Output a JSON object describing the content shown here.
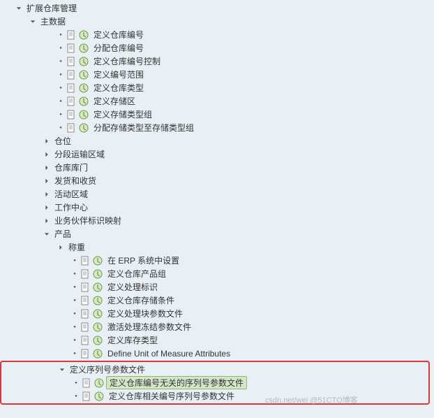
{
  "tree": {
    "root_label": "扩展仓库管理",
    "master_data_label": "主数据",
    "items": [
      "定义仓库编号",
      "分配仓库编号",
      "定义仓库编号控制",
      "定义编号范围",
      "定义仓库类型",
      "定义存储区",
      "定义存储类型组",
      "分配存储类型至存储类型组"
    ],
    "folders": [
      "仓位",
      "分段运输区域",
      "仓库库门",
      "发货和收货",
      "活动区域",
      "工作中心",
      "业务伙伴标识映射"
    ],
    "product_label": "产品",
    "product_first": "称重",
    "product_items": [
      "在 ERP 系统中设置",
      "定义仓库产品组",
      "定义处理标识",
      "定义仓库存储条件",
      "定义处理块参数文件",
      "激活处理冻结参数文件",
      "定义库存类型",
      "Define Unit of Measure Attributes"
    ],
    "serial_label": "定义序列号参数文件",
    "serial_items": [
      "定义仓库编号无关的序列号参数文件",
      "定义仓库相关编号序列号参数文件"
    ]
  },
  "watermark": "csdn.net/wei @51CTO博客"
}
